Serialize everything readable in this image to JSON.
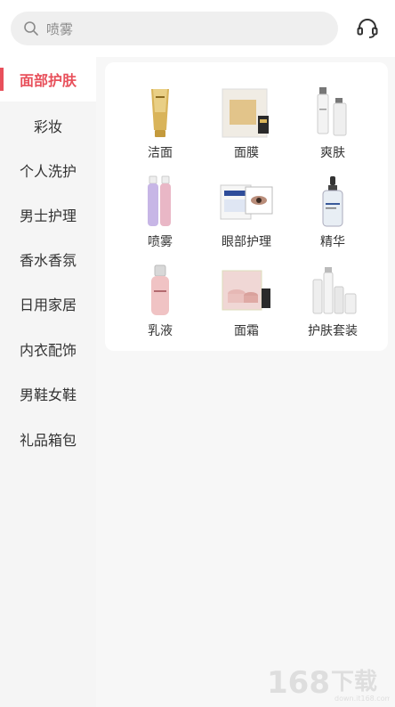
{
  "search": {
    "placeholder": "喷雾"
  },
  "sidebar": {
    "items": [
      {
        "label": "面部护肤",
        "active": true
      },
      {
        "label": "彩妆"
      },
      {
        "label": "个人洗护"
      },
      {
        "label": "男士护理"
      },
      {
        "label": "香水香氛"
      },
      {
        "label": "日用家居"
      },
      {
        "label": "内衣配饰"
      },
      {
        "label": "男鞋女鞋"
      },
      {
        "label": "礼品箱包"
      }
    ]
  },
  "categories": [
    {
      "label": "洁面",
      "icon": "cleanser-tube-icon"
    },
    {
      "label": "面膜",
      "icon": "face-mask-pack-icon"
    },
    {
      "label": "爽肤",
      "icon": "toner-bottles-icon"
    },
    {
      "label": "喷雾",
      "icon": "spray-bottles-icon"
    },
    {
      "label": "眼部护理",
      "icon": "eye-patch-box-icon"
    },
    {
      "label": "精华",
      "icon": "serum-dropper-icon"
    },
    {
      "label": "乳液",
      "icon": "lotion-bottle-icon"
    },
    {
      "label": "面霜",
      "icon": "cream-jar-set-icon"
    },
    {
      "label": "护肤套装",
      "icon": "skincare-set-icon"
    }
  ],
  "watermark": {
    "text": "168下载",
    "url_text": "down.it168.com"
  },
  "colors": {
    "accent": "#e8505b"
  }
}
